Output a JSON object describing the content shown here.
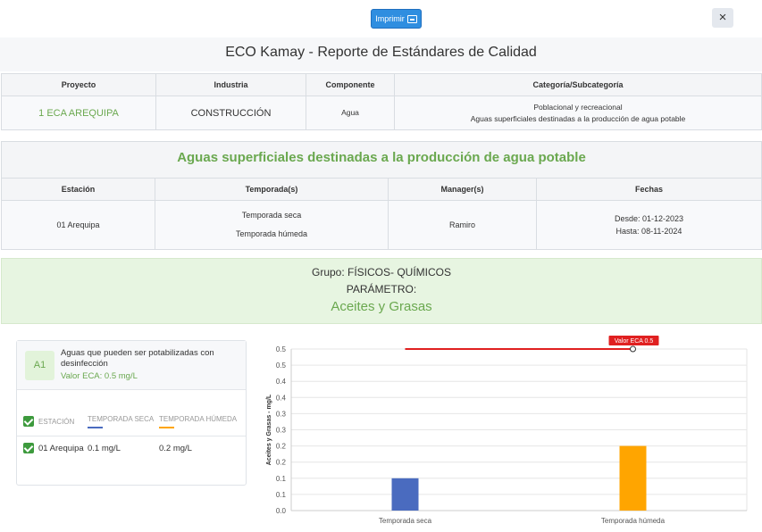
{
  "toolbar": {
    "print_label": "Imprimir",
    "close_label": "×"
  },
  "report_title": "ECO Kamay - Reporte de Estándares de Calidad",
  "project_table": {
    "headers": [
      "Proyecto",
      "Industria",
      "Componente",
      "Categoría/Subcategoría"
    ],
    "project": "1 ECA AREQUIPA",
    "industry": "CONSTRUCCIÓN",
    "component": "Agua",
    "category": "Poblacional y recreacional",
    "subcategory": "Aguas superficiales destinadas a la producción de agua potable"
  },
  "section": {
    "title": "Aguas superficiales destinadas a la producción de agua potable",
    "headers": [
      "Estación",
      "Temporada(s)",
      "Manager(s)",
      "Fechas"
    ],
    "station": "01 Arequipa",
    "season_dry": "Temporada seca",
    "season_wet": "Temporada húmeda",
    "manager": "Ramiro",
    "date_from": "Desde: 01-12-2023",
    "date_to": "Hasta: 08-11-2024"
  },
  "group": {
    "group_label": "Grupo: FÍSICOS- QUÍMICOS",
    "param_label": "PARÁMETRO:",
    "param_name": "Aceites y Grasas"
  },
  "card": {
    "code": "A1",
    "description": "Aguas que pueden ser potabilizadas con desinfección",
    "eca_value": "Valor ECA: 0.5 mg/L",
    "col_station": "ESTACIÓN",
    "col_dry": "TEMPORADA SECA",
    "col_wet": "TEMPORADA HÚMEDA",
    "row_station": "01 Arequipa",
    "row_dry": "0.1 mg/L",
    "row_wet": "0.2 mg/L",
    "color_dry": "#4a6bbf",
    "color_wet": "#ffa500"
  },
  "chart_data": {
    "type": "bar",
    "categories": [
      "Temporada seca",
      "Temporada húmeda"
    ],
    "values": [
      0.1,
      0.2
    ],
    "colors": [
      "#4a6bbf",
      "#ffa500"
    ],
    "ylabel": "Aceites y Grasas - mg/L",
    "ylim": [
      0,
      0.5
    ],
    "yticks": [
      "0.0",
      "0.1",
      "0.1",
      "0.2",
      "0.2",
      "0.3",
      "0.3",
      "0.4",
      "0.4",
      "0.5",
      "0.5"
    ],
    "reference_line": {
      "label": "Valor ECA 0.5",
      "value": 0.5,
      "color": "#e02020"
    },
    "grid": true
  }
}
